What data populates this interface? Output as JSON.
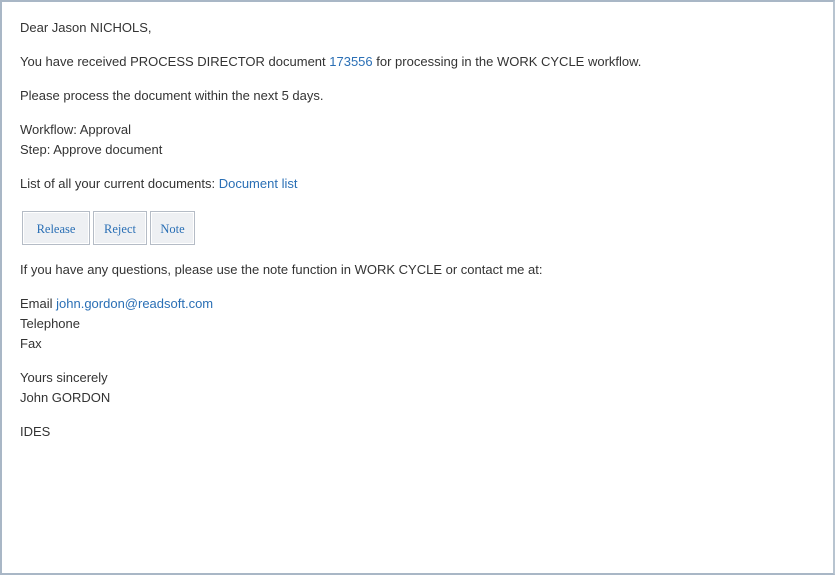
{
  "email": {
    "greeting": "Dear Jason NICHOLS,",
    "received": {
      "prefix": "You have received PROCESS DIRECTOR document ",
      "document_number": "173556",
      "suffix": " for processing in the WORK CYCLE workflow."
    },
    "instruction": "Please process the document within the next 5 days.",
    "workflow_line": "Workflow: Approval",
    "step_line": "Step: Approve document",
    "document_list": {
      "prefix": "List of all your current documents: ",
      "link_label": "Document list"
    },
    "actions": {
      "release_label": "Release",
      "reject_label": "Reject",
      "note_label": "Note"
    },
    "questions": "If you have any questions, please use the note function in WORK CYCLE or contact me at:",
    "contact": {
      "email_label": "Email ",
      "email_address": "john.gordon@readsoft.com",
      "telephone_label": "Telephone",
      "fax_label": "Fax"
    },
    "closing": "Yours sincerely",
    "sender_name": "John GORDON",
    "organization": "IDES"
  }
}
